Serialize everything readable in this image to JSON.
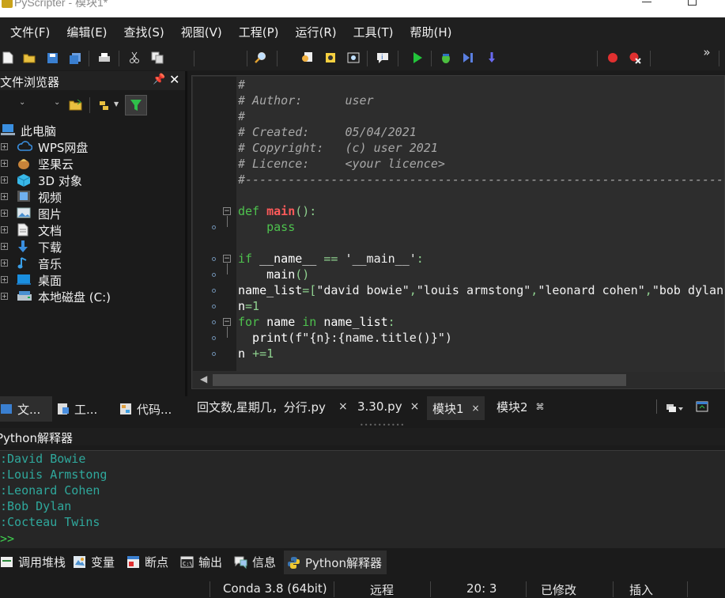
{
  "window": {
    "title": "PyScripter - 模块1*"
  },
  "menu": [
    "文件(F)",
    "编辑(E)",
    "查找(S)",
    "视图(V)",
    "工程(P)",
    "运行(R)",
    "工具(T)",
    "帮助(H)"
  ],
  "toolbar": {
    "overflow_label": "»",
    "icons": [
      "new-file-icon",
      "open-folder-icon",
      "save-icon",
      "save-all-icon",
      "print-icon",
      "cut-icon",
      "copy-icon",
      "search-icon",
      "find-in-files-icon",
      "highlight-icon",
      "zoom-icon",
      "info-icon",
      "run-icon",
      "debug-icon",
      "step-into-icon",
      "step-over-icon",
      "breakpoint-icon",
      "clear-breakpoints-icon"
    ]
  },
  "file_explorer": {
    "title": "文件浏览器",
    "items": [
      {
        "label": "此电脑",
        "icon": "computer-icon"
      },
      {
        "label": "WPS网盘",
        "icon": "cloud-icon"
      },
      {
        "label": "坚果云",
        "icon": "nut-icon"
      },
      {
        "label": "3D 对象",
        "icon": "cube-icon"
      },
      {
        "label": "视频",
        "icon": "video-icon"
      },
      {
        "label": "图片",
        "icon": "picture-icon"
      },
      {
        "label": "文档",
        "icon": "document-icon"
      },
      {
        "label": "下载",
        "icon": "download-icon"
      },
      {
        "label": "音乐",
        "icon": "music-icon"
      },
      {
        "label": "桌面",
        "icon": "desktop-icon"
      },
      {
        "label": "本地磁盘 (C:)",
        "icon": "drive-icon"
      }
    ],
    "tabs": [
      "文...",
      "工...",
      "代码..."
    ]
  },
  "editor": {
    "lines": [
      [
        [
          "#",
          "cm"
        ]
      ],
      [
        [
          "# Author:      user",
          "cm"
        ]
      ],
      [
        [
          "#",
          "cm"
        ]
      ],
      [
        [
          "# Created:     05/04/2021",
          "cm"
        ]
      ],
      [
        [
          "# Copyright:   (c) user 2021",
          "cm"
        ]
      ],
      [
        [
          "# Licence:     <your licence>",
          "cm"
        ]
      ],
      [
        [
          "#-------------------------------------------------------------------------------",
          "cm"
        ]
      ],
      [],
      [
        [
          "def ",
          "kw"
        ],
        [
          "main",
          "fn"
        ],
        [
          "():",
          "op"
        ]
      ],
      [
        [
          "    ",
          "nm"
        ],
        [
          "pass",
          "kw"
        ]
      ],
      [],
      [
        [
          "if ",
          "kw"
        ],
        [
          "__name__ ",
          "nm"
        ],
        [
          "== ",
          "op"
        ],
        [
          "'__main__'",
          "st"
        ],
        [
          ":",
          "op"
        ]
      ],
      [
        [
          "    main",
          "nm"
        ],
        [
          "()",
          "op"
        ]
      ],
      [
        [
          "name_list",
          "nm"
        ],
        [
          "=[",
          "op"
        ],
        [
          "\"david bowie\"",
          "st"
        ],
        [
          ",",
          "op"
        ],
        [
          "\"louis armstong\"",
          "st"
        ],
        [
          ",",
          "op"
        ],
        [
          "\"leonard cohen\"",
          "st"
        ],
        [
          ",",
          "op"
        ],
        [
          "\"bob dylan\"",
          "st"
        ]
      ],
      [
        [
          "n",
          "nm"
        ],
        [
          "=1",
          "op"
        ]
      ],
      [
        [
          "for ",
          "kw"
        ],
        [
          "name ",
          "nm"
        ],
        [
          "in ",
          "kw"
        ],
        [
          "name_list",
          "nm"
        ],
        [
          ":",
          "op"
        ]
      ],
      [
        [
          "  print",
          "nm"
        ],
        [
          "(f\"",
          "st"
        ],
        [
          "{n}:{name.title()}",
          "st"
        ],
        [
          "\")",
          "st"
        ]
      ],
      [
        [
          "n ",
          "nm"
        ],
        [
          "+=1",
          "op"
        ]
      ]
    ],
    "tabs": [
      {
        "label": "回文数,星期几，分行.py",
        "close": "×"
      },
      {
        "label": "3.30.py",
        "close": "×"
      },
      {
        "label": "模块1",
        "close": "×"
      },
      {
        "label": "模块2",
        "close": "⌘"
      }
    ]
  },
  "interpreter": {
    "title": "Python解释器",
    "output": [
      ":David Bowie",
      ":Louis Armstong",
      ":Leonard Cohen",
      ":Bob Dylan",
      ":Cocteau Twins"
    ],
    "prompt": ">>"
  },
  "bottom_tabs": [
    {
      "label": "调用堆栈",
      "icon": "call-stack-icon"
    },
    {
      "label": "变量",
      "icon": "variables-icon"
    },
    {
      "label": "断点",
      "icon": "breakpoints-icon"
    },
    {
      "label": "输出",
      "icon": "output-icon"
    },
    {
      "label": "信息",
      "icon": "messages-icon"
    },
    {
      "label": "Python解释器",
      "icon": "python-icon"
    }
  ],
  "status": {
    "python_version": "Conda 3.8 (64bit)",
    "remote": "远程",
    "position": "20:  3",
    "modified": "已修改",
    "insert_mode": "插入"
  }
}
